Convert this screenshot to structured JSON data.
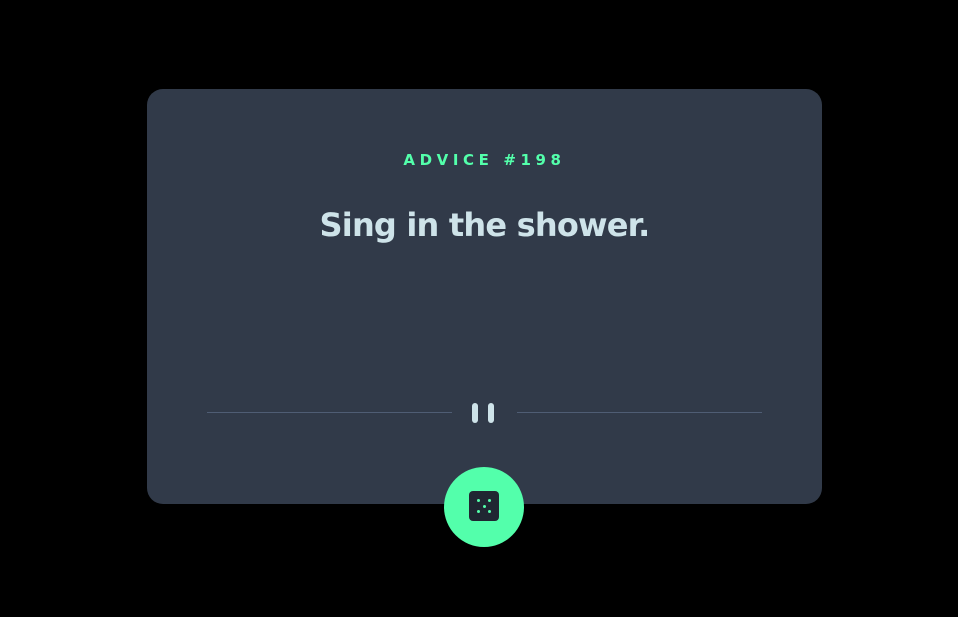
{
  "advice": {
    "label": "ADVICE #198",
    "text": "Sing in the shower."
  },
  "divider": {
    "icon": "pause-icon"
  },
  "dice_button": {
    "icon": "dice-icon"
  },
  "colors": {
    "background": "#000000",
    "card": "#313a49",
    "accent": "#53ffab",
    "text": "#cee3e9",
    "divider_line": "#4f5d74",
    "dice_face": "#202632"
  }
}
